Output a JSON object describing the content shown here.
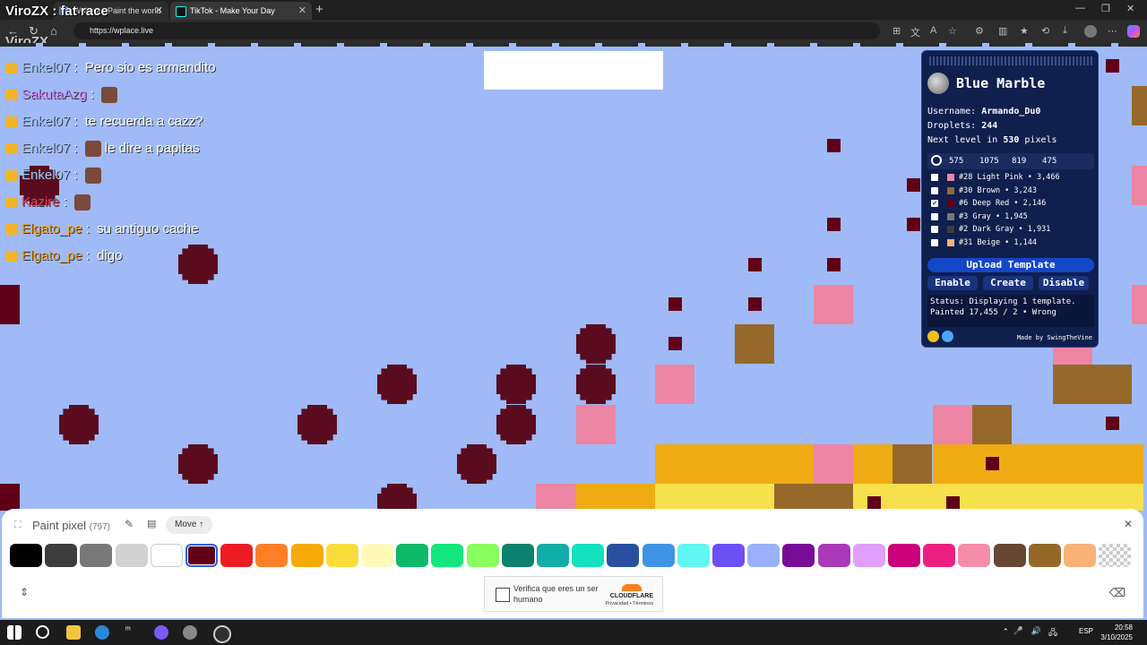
{
  "stream": {
    "title": "ViroZX : fat race",
    "title_shadow": "ViroZX"
  },
  "browser": {
    "tabs": [
      {
        "label": "Wplace - Paint the world",
        "active": false
      },
      {
        "label": "TikTok - Make Your Day",
        "active": true
      }
    ],
    "url": "https://wplace.live"
  },
  "chat": [
    {
      "user": "Enkel07",
      "color": "#9fc7ff",
      "message": "Pero sio es armandito",
      "emote": false
    },
    {
      "user": "SakutaAzg",
      "color": "#d080ff",
      "message": "",
      "emote": true
    },
    {
      "user": "Enkel07",
      "color": "#9fc7ff",
      "message": "te recuerda a cazz?",
      "emote": false
    },
    {
      "user": "Enkel07",
      "color": "#9fc7ff",
      "message": "le dire a papitas",
      "emote": true
    },
    {
      "user": "Enkel07",
      "color": "#9fc7ff",
      "message": "",
      "emote": true
    },
    {
      "user": "Kazire",
      "color": "#ff3060",
      "message": "",
      "emote": true
    },
    {
      "user": "Elgato_pe",
      "color": "#f5a623",
      "message": "su antiguo cache",
      "emote": false
    },
    {
      "user": "Elgato_pe",
      "color": "#f5a623",
      "message": "digo",
      "emote": false
    }
  ],
  "blue_marble": {
    "title": "Blue Marble",
    "username_label": "Username:",
    "username": "Armando_Du0",
    "droplets_label": "Droplets:",
    "droplets": "244",
    "next_level_prefix": "Next level in",
    "next_level_value": "530",
    "next_level_suffix": "pixels",
    "coords": [
      "575",
      "1075",
      "819",
      "475"
    ],
    "colors": [
      {
        "label": "#28 Light Pink • 3,466",
        "checked": false,
        "swatch": "#ec86a4"
      },
      {
        "label": "#30 Brown • 3,243",
        "checked": false,
        "swatch": "#96692b"
      },
      {
        "label": "#6 Deep Red • 2,146",
        "checked": true,
        "swatch": "#600018"
      },
      {
        "label": "#3 Gray • 1,945",
        "checked": false,
        "swatch": "#787878"
      },
      {
        "label": "#2 Dark Gray • 1,931",
        "checked": false,
        "swatch": "#3c3c3c"
      },
      {
        "label": "#31 Beige • 1,144",
        "checked": false,
        "swatch": "#f8b277"
      }
    ],
    "upload_label": "Upload Template",
    "enable_label": "Enable",
    "create_label": "Create",
    "disable_label": "Disable",
    "status_text": "Status: Displaying 1 template.",
    "status_text2": "Painted 17,455 / 2 • Wrong",
    "made_by": "Made by SwingTheVine"
  },
  "paint": {
    "title": "Paint pixel",
    "count": "(797)",
    "move_label": "Move ↑",
    "palette": [
      "#000000",
      "#3c3c3c",
      "#787878",
      "#d2d2d2",
      "#ffffff",
      "#600018",
      "#ed1c24",
      "#ff7f27",
      "#f6aa09",
      "#f9dd3b",
      "#fffabc",
      "#0eb968",
      "#13e67b",
      "#87ff5e",
      "#0c816e",
      "#10aea6",
      "#13e1be",
      "#28509e",
      "#4093e4",
      "#60f7f2",
      "#6b50f6",
      "#99b1fb",
      "#780c99",
      "#aa38b9",
      "#e09ff9",
      "#cb007a",
      "#ec1f80",
      "#f38da9",
      "#684634",
      "#95682a",
      "#f8b277",
      "transparent"
    ],
    "selected_index": 5
  },
  "captcha": {
    "text": "Verifica que eres un ser humano",
    "brand": "CLOUDFLARE",
    "legal": "Privacidad • Términos"
  },
  "taskbar": {
    "time": "20:58",
    "date": "3/10/2025",
    "lang": "ESP"
  }
}
